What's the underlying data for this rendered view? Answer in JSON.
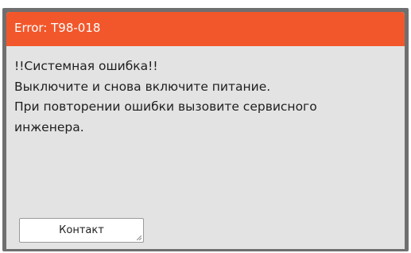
{
  "dialog": {
    "title": "Error: T98-018",
    "message_lines": [
      "!!Системная ошибка!!",
      "Выключите и снова включите питание.",
      "При повторении ошибки вызовите сервисного",
      "инженера."
    ],
    "contact_label": "Контакт"
  },
  "colors": {
    "titlebar": "#f2572b",
    "body": "#e3e3e3",
    "frame": "#6f6f6f"
  }
}
